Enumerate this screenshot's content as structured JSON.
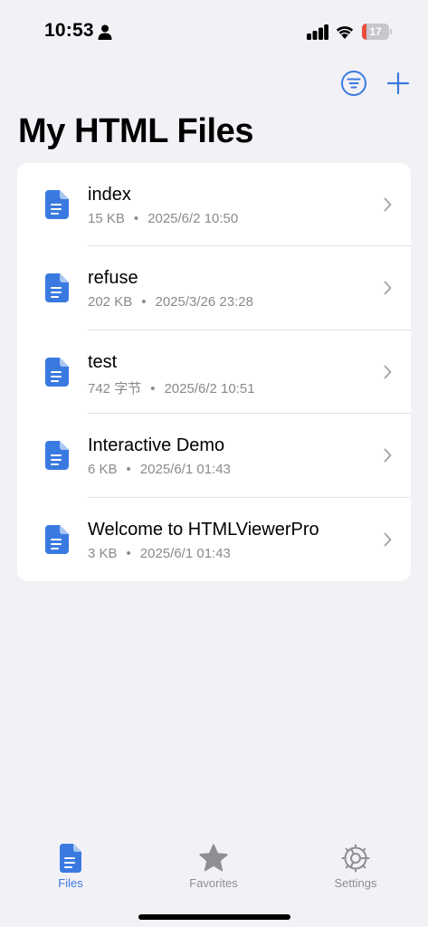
{
  "status_bar": {
    "time": "10:53",
    "battery_level": "17",
    "battery_fraction": 0.17,
    "battery_color": "#eb4e3d",
    "icons": [
      "person-icon",
      "cellular-signal-icon",
      "wifi-icon",
      "battery-icon"
    ]
  },
  "nav": {
    "actions": [
      "filter-icon",
      "plus-icon"
    ],
    "accent": "#3a7ae0"
  },
  "page": {
    "title": "My HTML Files"
  },
  "files": [
    {
      "name": "index",
      "size": "15 KB",
      "date": "2025/6/2 10:50"
    },
    {
      "name": "refuse",
      "size": "202 KB",
      "date": "2025/3/26 23:28"
    },
    {
      "name": "test",
      "size": "742 字节",
      "date": "2025/6/2 10:51"
    },
    {
      "name": "Interactive Demo",
      "size": "6 KB",
      "date": "2025/6/1 01:43"
    },
    {
      "name": "Welcome to HTMLViewerPro",
      "size": "3 KB",
      "date": "2025/6/1 01:43"
    }
  ],
  "file_meta_separator": "•",
  "tabs": [
    {
      "label": "Files",
      "icon": "doc-icon",
      "active": true
    },
    {
      "label": "Favorites",
      "icon": "star-icon",
      "active": false
    },
    {
      "label": "Settings",
      "icon": "gear-icon",
      "active": false
    }
  ]
}
